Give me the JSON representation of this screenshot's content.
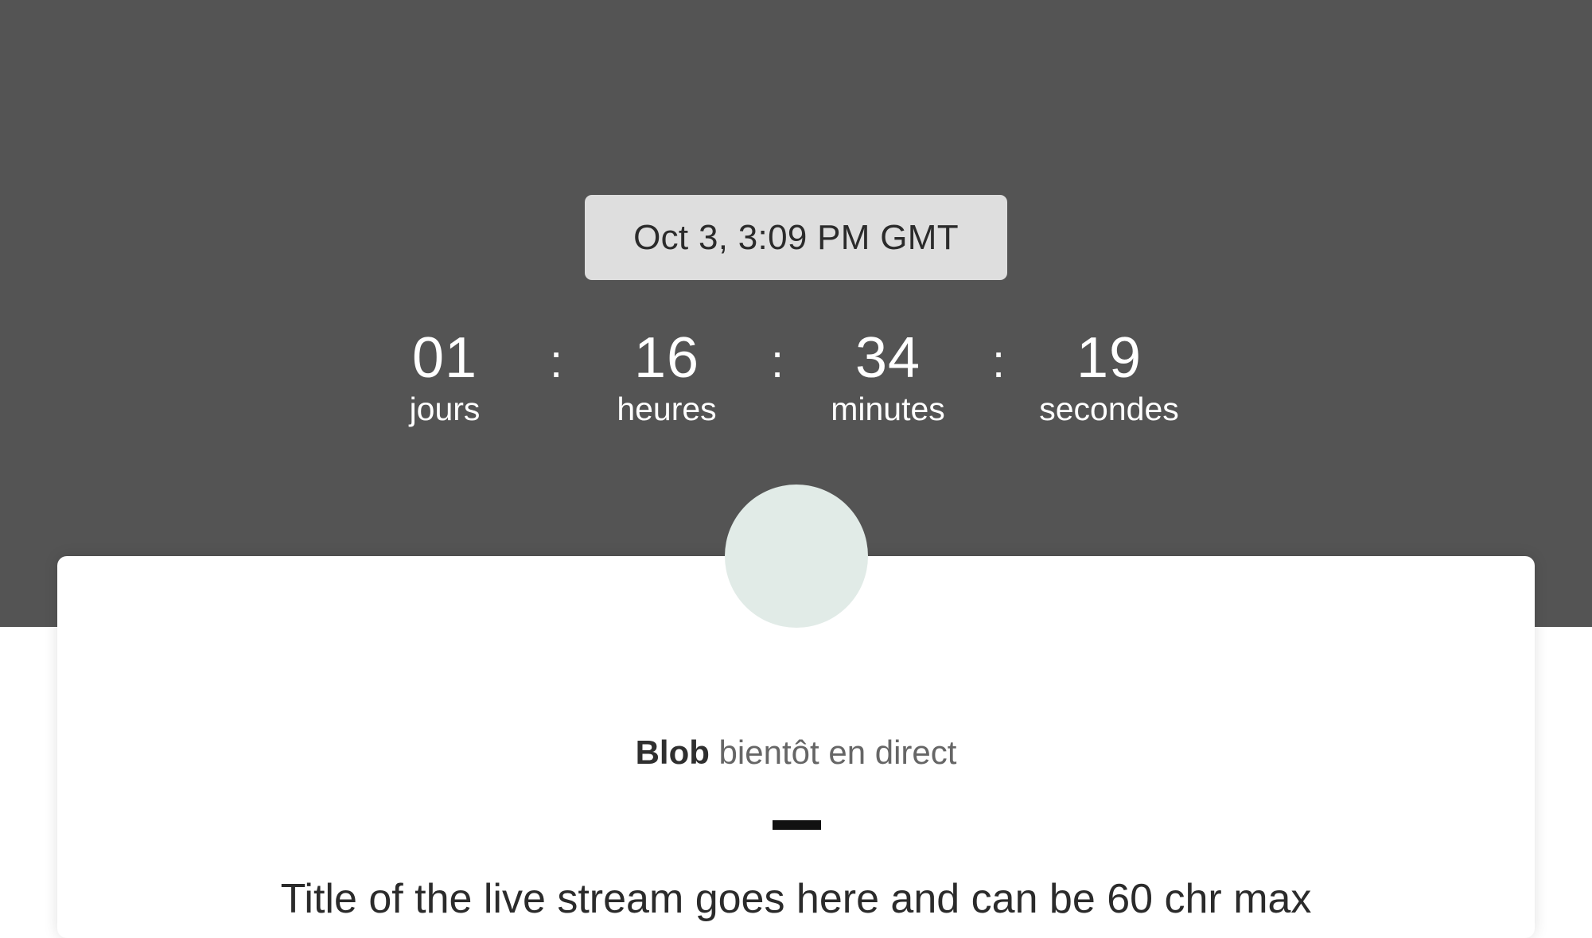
{
  "schedule": {
    "date_label": "Oct 3, 3:09 PM GMT"
  },
  "countdown": {
    "units": [
      {
        "value": "01",
        "label": "jours"
      },
      {
        "value": "16",
        "label": "heures"
      },
      {
        "value": "34",
        "label": "minutes"
      },
      {
        "value": "19",
        "label": "secondes"
      }
    ],
    "separator": ":"
  },
  "card": {
    "streamer_name": "Blob",
    "status_text": " bientôt en direct",
    "stream_title": "Title of the live stream goes here and can be 60 chr max"
  },
  "colors": {
    "hero_background": "#545454",
    "date_badge_background": "#dedede",
    "avatar_placeholder": "#e1ebe7",
    "divider": "#111111"
  }
}
